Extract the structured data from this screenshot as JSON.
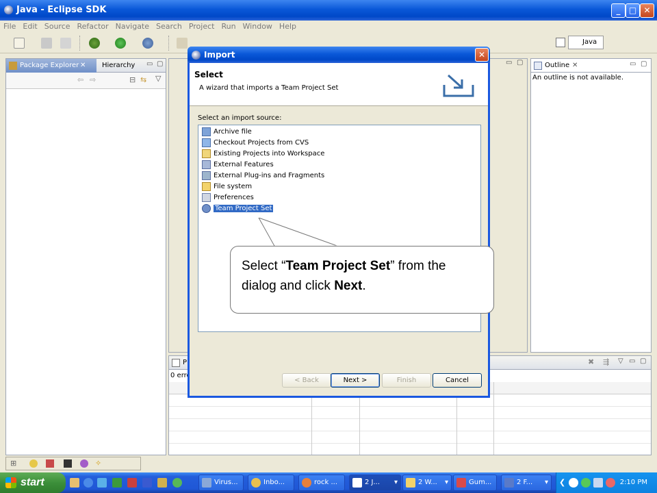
{
  "window": {
    "title": "Java - Eclipse SDK"
  },
  "menu": [
    "File",
    "Edit",
    "Source",
    "Refactor",
    "Navigate",
    "Search",
    "Project",
    "Run",
    "Window",
    "Help"
  ],
  "perspective": {
    "label": "Java"
  },
  "left_view": {
    "tabs": [
      "Package Explorer",
      "Hierarchy"
    ]
  },
  "outline_view": {
    "tab": "Outline",
    "message": "An outline is not available."
  },
  "bottom_view": {
    "tab_partial": "P",
    "status_partial": "0 erro"
  },
  "dialog": {
    "title": "Import",
    "wizard_title": "Select",
    "wizard_desc": "A wizard that imports a Team Project Set",
    "source_label": "Select an import source:",
    "items": [
      {
        "label": "Archive file",
        "icon": "archive-icon"
      },
      {
        "label": "Checkout Projects from CVS",
        "icon": "cvs-checkout-icon"
      },
      {
        "label": "Existing Projects into Workspace",
        "icon": "project-icon"
      },
      {
        "label": "External Features",
        "icon": "feature-icon"
      },
      {
        "label": "External Plug-ins and Fragments",
        "icon": "plugin-icon"
      },
      {
        "label": "File system",
        "icon": "folder-icon"
      },
      {
        "label": "Preferences",
        "icon": "preferences-icon"
      },
      {
        "label": "Team Project Set",
        "icon": "team-project-set-icon"
      }
    ],
    "selected_item": "Team Project Set",
    "buttons": {
      "back": "< Back",
      "next": "Next >",
      "finish": "Finish",
      "cancel": "Cancel"
    }
  },
  "callout": {
    "p1": "Select “",
    "bold1": "Team Project Set",
    "p2": "” from the dialog and click ",
    "bold2": "Next",
    "p3": "."
  },
  "taskbar": {
    "start": "start",
    "tasks": [
      "Virus...",
      "Inbo...",
      "rock ...",
      "2 J...",
      "2 W...",
      "Gum...",
      "2 F..."
    ],
    "clock": "2:10 PM"
  },
  "colors": {
    "xp_blue": "#0a58d8",
    "selection": "#316ac5",
    "start_green": "#3c8f3a"
  }
}
